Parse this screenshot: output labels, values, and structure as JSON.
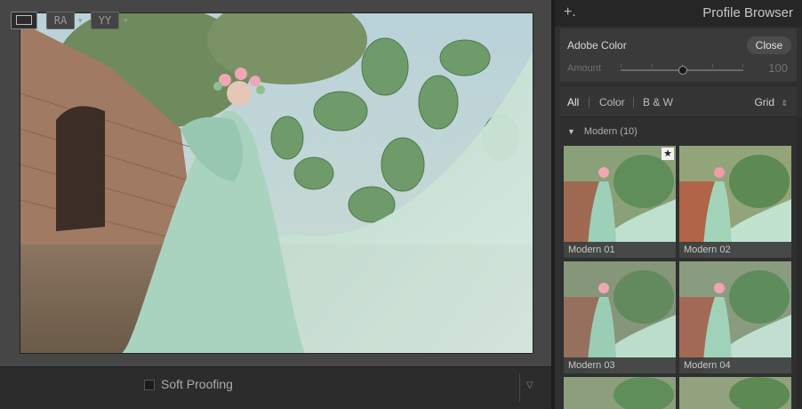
{
  "toolbar": {
    "ra_label": "RA",
    "yy_label": "YY",
    "soft_proofing_label": "Soft Proofing",
    "menu_caret": "▽"
  },
  "panel": {
    "add_label": "+.",
    "title": "Profile Browser",
    "profile_name": "Adobe Color",
    "close_label": "Close",
    "amount_label": "Amount",
    "amount_value": "100",
    "filters": [
      "All",
      "Color",
      "B & W"
    ],
    "view_mode": "Grid",
    "view_mode_caret": "⌃",
    "group_label": "Modern (10)",
    "thumbnails": [
      "Modern 01",
      "Modern 02",
      "Modern 03",
      "Modern 04"
    ],
    "favorite_icon": "star-icon"
  },
  "colors": {
    "panel_bg": "#2f2f2f",
    "accent_light": "#e8e8e8",
    "dress": "#a8d4c0"
  }
}
